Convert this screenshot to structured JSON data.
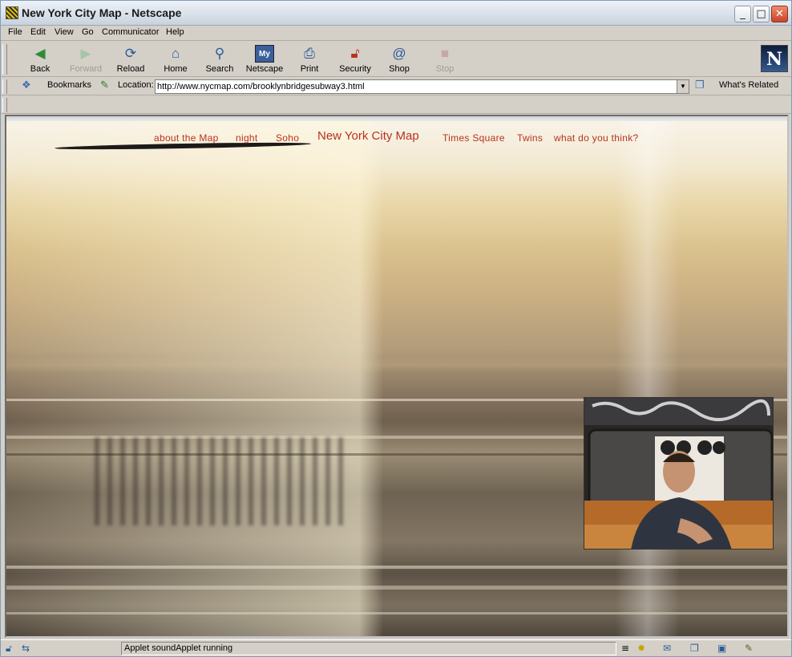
{
  "window": {
    "title": "New York City Map - Netscape",
    "controls": {
      "minimize": "_",
      "maximize": "□",
      "close": "✕"
    }
  },
  "menubar": [
    "File",
    "Edit",
    "View",
    "Go",
    "Communicator",
    "Help"
  ],
  "toolbar": {
    "buttons": [
      {
        "label": "Back",
        "icon": "back-arrow-icon",
        "enabled": true
      },
      {
        "label": "Forward",
        "icon": "forward-arrow-icon",
        "enabled": false
      },
      {
        "label": "Reload",
        "icon": "reload-icon",
        "enabled": true
      },
      {
        "label": "Home",
        "icon": "home-icon",
        "enabled": true
      },
      {
        "label": "Search",
        "icon": "search-icon",
        "enabled": true
      },
      {
        "label": "Netscape",
        "icon": "my-netscape-icon",
        "enabled": true
      },
      {
        "label": "Print",
        "icon": "print-icon",
        "enabled": true
      },
      {
        "label": "Security",
        "icon": "padlock-icon",
        "enabled": true
      },
      {
        "label": "Shop",
        "icon": "shop-icon",
        "enabled": true
      },
      {
        "label": "Stop",
        "icon": "stop-icon",
        "enabled": false
      }
    ],
    "logo": "N"
  },
  "locationbar": {
    "bookmarks_label": "Bookmarks",
    "location_label": "Location:",
    "url": "http://www.nycmap.com/brooklynbridgesubway3.html",
    "whats_related_label": "What's Related"
  },
  "page": {
    "nav": {
      "links": [
        "about the Map",
        "night",
        "Soho"
      ],
      "title": "New York City Map",
      "links_right": [
        "Times Square",
        "Twins",
        "what do you think?"
      ]
    },
    "colors": {
      "nav_text": "#b8321f"
    }
  },
  "status": {
    "text": "Applet soundApplet running"
  }
}
